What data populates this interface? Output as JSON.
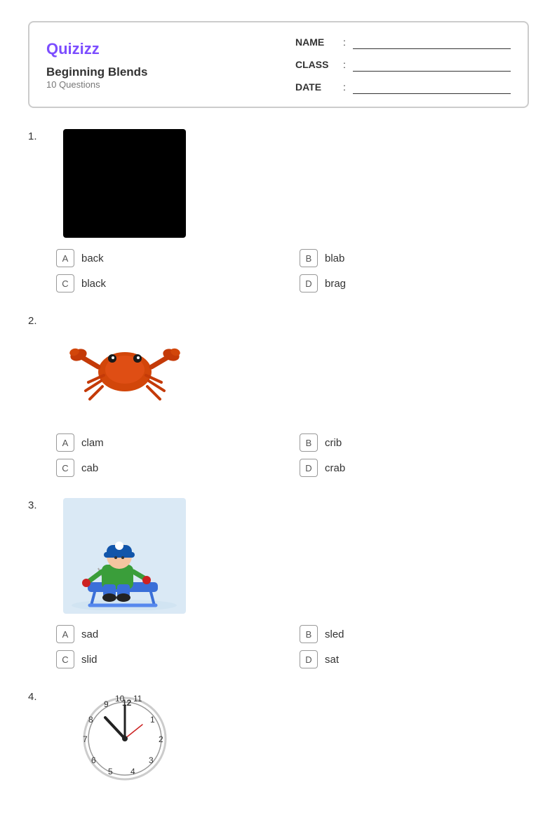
{
  "header": {
    "logo": "Quizizz",
    "title": "Beginning Blends",
    "subtitle": "10 Questions",
    "fields": {
      "name_label": "NAME",
      "class_label": "CLASS",
      "date_label": "DATE"
    }
  },
  "questions": [
    {
      "number": "1.",
      "image_type": "black",
      "answers": [
        {
          "letter": "A",
          "text": "back"
        },
        {
          "letter": "B",
          "text": "blab"
        },
        {
          "letter": "C",
          "text": "black"
        },
        {
          "letter": "D",
          "text": "brag"
        }
      ]
    },
    {
      "number": "2.",
      "image_type": "crab",
      "answers": [
        {
          "letter": "A",
          "text": "clam"
        },
        {
          "letter": "B",
          "text": "crib"
        },
        {
          "letter": "C",
          "text": "cab"
        },
        {
          "letter": "D",
          "text": "crab"
        }
      ]
    },
    {
      "number": "3.",
      "image_type": "sled",
      "answers": [
        {
          "letter": "A",
          "text": "sad"
        },
        {
          "letter": "B",
          "text": "sled"
        },
        {
          "letter": "C",
          "text": "slid"
        },
        {
          "letter": "D",
          "text": "sat"
        }
      ]
    },
    {
      "number": "4.",
      "image_type": "clock",
      "answers": []
    }
  ]
}
